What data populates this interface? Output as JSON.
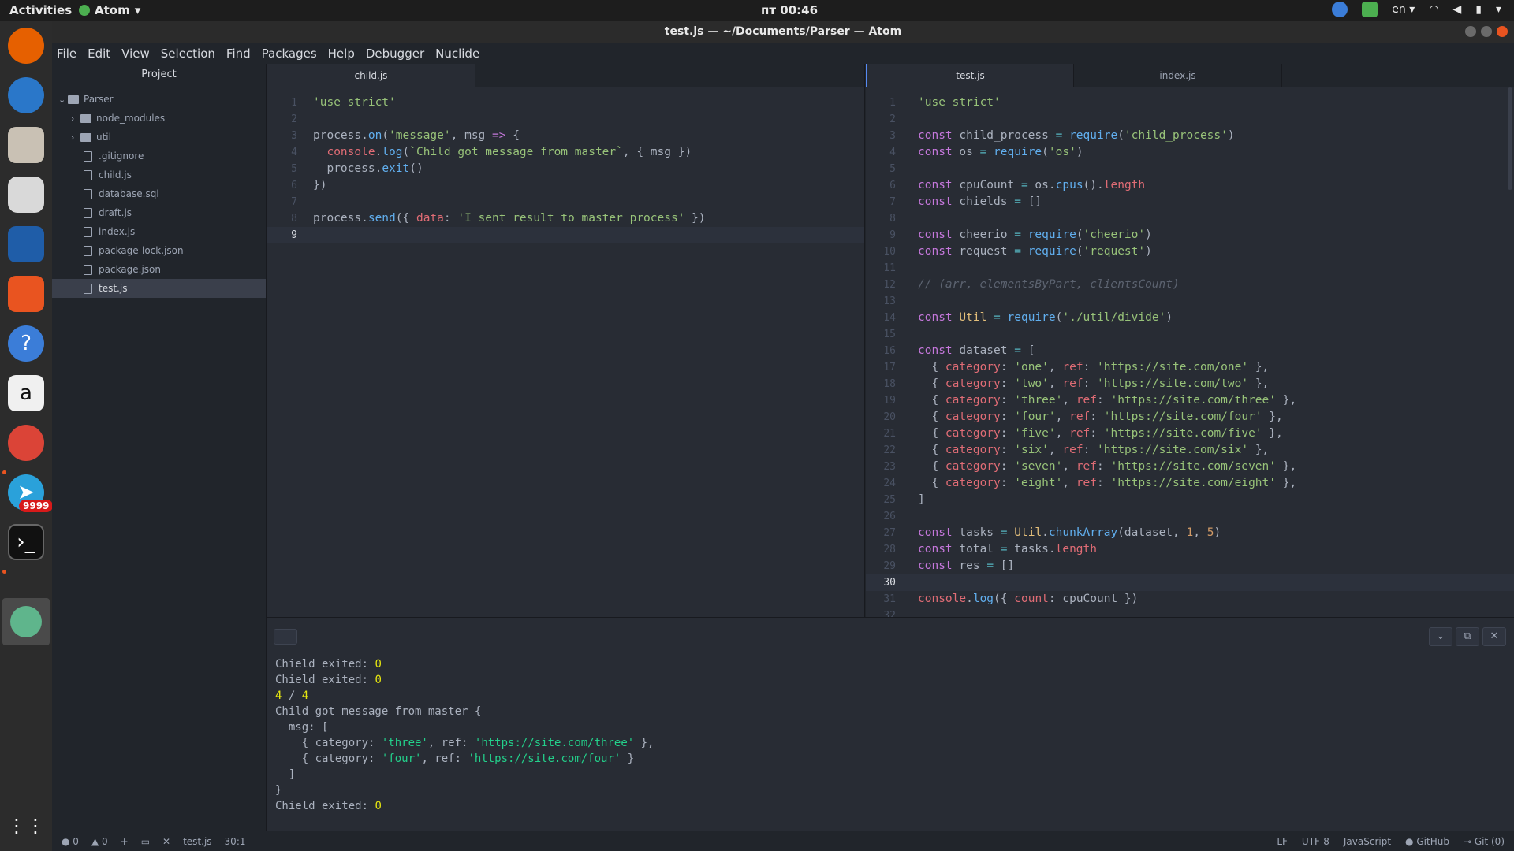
{
  "topbar": {
    "activities": "Activities",
    "app": "Atom",
    "clock": "пт 00:46",
    "lang": "en"
  },
  "window": {
    "title": "test.js — ~/Documents/Parser — Atom"
  },
  "dock": {
    "telegram_badge": "9999"
  },
  "menu": [
    "File",
    "Edit",
    "View",
    "Selection",
    "Find",
    "Packages",
    "Help",
    "Debugger",
    "Nuclide"
  ],
  "tree": {
    "header": "Project",
    "root": "Parser",
    "folders": [
      "node_modules",
      "util"
    ],
    "files": [
      ".gitignore",
      "child.js",
      "database.sql",
      "draft.js",
      "index.js",
      "package-lock.json",
      "package.json",
      "test.js"
    ]
  },
  "left_pane": {
    "tab": "child.js",
    "lines": [
      [
        [
          "s",
          "'use strict'"
        ]
      ],
      [],
      [
        [
          "t",
          "process."
        ],
        [
          "f",
          "on"
        ],
        [
          "t",
          "("
        ],
        [
          "s",
          "'message'"
        ],
        [
          "t",
          ", msg "
        ],
        [
          "k",
          "=>"
        ],
        [
          "t",
          " {"
        ]
      ],
      [
        [
          "t",
          "  "
        ],
        [
          "p",
          "console"
        ],
        [
          "t",
          "."
        ],
        [
          "f",
          "log"
        ],
        [
          "t",
          "("
        ],
        [
          "s",
          "`Child got message from master`"
        ],
        [
          "t",
          ", { msg })"
        ]
      ],
      [
        [
          "t",
          "  process."
        ],
        [
          "f",
          "exit"
        ],
        [
          "t",
          "()"
        ]
      ],
      [
        [
          "t",
          "})"
        ]
      ],
      [],
      [
        [
          "t",
          "process."
        ],
        [
          "f",
          "send"
        ],
        [
          "t",
          "({ "
        ],
        [
          "p",
          "data"
        ],
        [
          "t",
          ": "
        ],
        [
          "s",
          "'I sent result to master process'"
        ],
        [
          "t",
          " })"
        ]
      ],
      []
    ]
  },
  "right_pane": {
    "tabs": [
      "test.js",
      "index.js"
    ],
    "lines": [
      [
        [
          "s",
          "'use strict'"
        ]
      ],
      [],
      [
        [
          "k",
          "const"
        ],
        [
          "t",
          " child_process "
        ],
        [
          "o",
          "="
        ],
        [
          "t",
          " "
        ],
        [
          "f",
          "require"
        ],
        [
          "t",
          "("
        ],
        [
          "s",
          "'child_process'"
        ],
        [
          "t",
          ")"
        ]
      ],
      [
        [
          "k",
          "const"
        ],
        [
          "t",
          " os "
        ],
        [
          "o",
          "="
        ],
        [
          "t",
          " "
        ],
        [
          "f",
          "require"
        ],
        [
          "t",
          "("
        ],
        [
          "s",
          "'os'"
        ],
        [
          "t",
          ")"
        ]
      ],
      [],
      [
        [
          "k",
          "const"
        ],
        [
          "t",
          " cpuCount "
        ],
        [
          "o",
          "="
        ],
        [
          "t",
          " os."
        ],
        [
          "f",
          "cpus"
        ],
        [
          "t",
          "()."
        ],
        [
          "p",
          "length"
        ]
      ],
      [
        [
          "k",
          "const"
        ],
        [
          "t",
          " chields "
        ],
        [
          "o",
          "="
        ],
        [
          "t",
          " []"
        ]
      ],
      [],
      [
        [
          "k",
          "const"
        ],
        [
          "t",
          " cheerio "
        ],
        [
          "o",
          "="
        ],
        [
          "t",
          " "
        ],
        [
          "f",
          "require"
        ],
        [
          "t",
          "("
        ],
        [
          "s",
          "'cheerio'"
        ],
        [
          "t",
          ")"
        ]
      ],
      [
        [
          "k",
          "const"
        ],
        [
          "t",
          " request "
        ],
        [
          "o",
          "="
        ],
        [
          "t",
          " "
        ],
        [
          "f",
          "require"
        ],
        [
          "t",
          "("
        ],
        [
          "s",
          "'request'"
        ],
        [
          "t",
          ")"
        ]
      ],
      [],
      [
        [
          "c",
          "// (arr, elementsByPart, clientsCount)"
        ]
      ],
      [],
      [
        [
          "k",
          "const"
        ],
        [
          "t",
          " "
        ],
        [
          "y",
          "Util"
        ],
        [
          "t",
          " "
        ],
        [
          "o",
          "="
        ],
        [
          "t",
          " "
        ],
        [
          "f",
          "require"
        ],
        [
          "t",
          "("
        ],
        [
          "s",
          "'./util/divide'"
        ],
        [
          "t",
          ")"
        ]
      ],
      [],
      [
        [
          "k",
          "const"
        ],
        [
          "t",
          " dataset "
        ],
        [
          "o",
          "="
        ],
        [
          "t",
          " ["
        ]
      ],
      [
        [
          "t",
          "  { "
        ],
        [
          "p",
          "category"
        ],
        [
          "t",
          ": "
        ],
        [
          "s",
          "'one'"
        ],
        [
          "t",
          ", "
        ],
        [
          "p",
          "ref"
        ],
        [
          "t",
          ": "
        ],
        [
          "s",
          "'https://site.com/one'"
        ],
        [
          "t",
          " },"
        ]
      ],
      [
        [
          "t",
          "  { "
        ],
        [
          "p",
          "category"
        ],
        [
          "t",
          ": "
        ],
        [
          "s",
          "'two'"
        ],
        [
          "t",
          ", "
        ],
        [
          "p",
          "ref"
        ],
        [
          "t",
          ": "
        ],
        [
          "s",
          "'https://site.com/two'"
        ],
        [
          "t",
          " },"
        ]
      ],
      [
        [
          "t",
          "  { "
        ],
        [
          "p",
          "category"
        ],
        [
          "t",
          ": "
        ],
        [
          "s",
          "'three'"
        ],
        [
          "t",
          ", "
        ],
        [
          "p",
          "ref"
        ],
        [
          "t",
          ": "
        ],
        [
          "s",
          "'https://site.com/three'"
        ],
        [
          "t",
          " },"
        ]
      ],
      [
        [
          "t",
          "  { "
        ],
        [
          "p",
          "category"
        ],
        [
          "t",
          ": "
        ],
        [
          "s",
          "'four'"
        ],
        [
          "t",
          ", "
        ],
        [
          "p",
          "ref"
        ],
        [
          "t",
          ": "
        ],
        [
          "s",
          "'https://site.com/four'"
        ],
        [
          "t",
          " },"
        ]
      ],
      [
        [
          "t",
          "  { "
        ],
        [
          "p",
          "category"
        ],
        [
          "t",
          ": "
        ],
        [
          "s",
          "'five'"
        ],
        [
          "t",
          ", "
        ],
        [
          "p",
          "ref"
        ],
        [
          "t",
          ": "
        ],
        [
          "s",
          "'https://site.com/five'"
        ],
        [
          "t",
          " },"
        ]
      ],
      [
        [
          "t",
          "  { "
        ],
        [
          "p",
          "category"
        ],
        [
          "t",
          ": "
        ],
        [
          "s",
          "'six'"
        ],
        [
          "t",
          ", "
        ],
        [
          "p",
          "ref"
        ],
        [
          "t",
          ": "
        ],
        [
          "s",
          "'https://site.com/six'"
        ],
        [
          "t",
          " },"
        ]
      ],
      [
        [
          "t",
          "  { "
        ],
        [
          "p",
          "category"
        ],
        [
          "t",
          ": "
        ],
        [
          "s",
          "'seven'"
        ],
        [
          "t",
          ", "
        ],
        [
          "p",
          "ref"
        ],
        [
          "t",
          ": "
        ],
        [
          "s",
          "'https://site.com/seven'"
        ],
        [
          "t",
          " },"
        ]
      ],
      [
        [
          "t",
          "  { "
        ],
        [
          "p",
          "category"
        ],
        [
          "t",
          ": "
        ],
        [
          "s",
          "'eight'"
        ],
        [
          "t",
          ", "
        ],
        [
          "p",
          "ref"
        ],
        [
          "t",
          ": "
        ],
        [
          "s",
          "'https://site.com/eight'"
        ],
        [
          "t",
          " },"
        ]
      ],
      [
        [
          "t",
          "]"
        ]
      ],
      [],
      [
        [
          "k",
          "const"
        ],
        [
          "t",
          " tasks "
        ],
        [
          "o",
          "="
        ],
        [
          "t",
          " "
        ],
        [
          "y",
          "Util"
        ],
        [
          "t",
          "."
        ],
        [
          "f",
          "chunkArray"
        ],
        [
          "t",
          "(dataset, "
        ],
        [
          "n",
          "1"
        ],
        [
          "t",
          ", "
        ],
        [
          "n",
          "5"
        ],
        [
          "t",
          ")"
        ]
      ],
      [
        [
          "k",
          "const"
        ],
        [
          "t",
          " total "
        ],
        [
          "o",
          "="
        ],
        [
          "t",
          " tasks."
        ],
        [
          "p",
          "length"
        ]
      ],
      [
        [
          "k",
          "const"
        ],
        [
          "t",
          " res "
        ],
        [
          "o",
          "="
        ],
        [
          "t",
          " []"
        ]
      ],
      [],
      [
        [
          "p",
          "console"
        ],
        [
          "t",
          "."
        ],
        [
          "f",
          "log"
        ],
        [
          "t",
          "({ "
        ],
        [
          "p",
          "count"
        ],
        [
          "t",
          ": cpuCount })"
        ]
      ],
      []
    ]
  },
  "console": {
    "lines": [
      [
        [
          "t",
          "Chield exited: "
        ],
        [
          "n",
          "0"
        ]
      ],
      [
        [
          "t",
          "Chield exited: "
        ],
        [
          "n",
          "0"
        ]
      ],
      [
        [
          "n",
          "4"
        ],
        [
          "t",
          " / "
        ],
        [
          "n",
          "4"
        ]
      ],
      [
        [
          "t",
          "Child got message from master {"
        ]
      ],
      [
        [
          "t",
          "  msg: ["
        ]
      ],
      [
        [
          "t",
          "    { category: "
        ],
        [
          "s",
          "'three'"
        ],
        [
          "t",
          ", ref: "
        ],
        [
          "s",
          "'https://site.com/three'"
        ],
        [
          "t",
          " },"
        ]
      ],
      [
        [
          "t",
          "    { category: "
        ],
        [
          "s",
          "'four'"
        ],
        [
          "t",
          ", ref: "
        ],
        [
          "s",
          "'https://site.com/four'"
        ],
        [
          "t",
          " }"
        ]
      ],
      [
        [
          "t",
          "  ]"
        ]
      ],
      [
        [
          "t",
          "}"
        ]
      ],
      [
        [
          "t",
          "Chield exited: "
        ],
        [
          "n",
          "0"
        ]
      ]
    ]
  },
  "status": {
    "errors": "0",
    "warnings": "0",
    "file": "test.js",
    "cursor": "30:1",
    "eol": "LF",
    "encoding": "UTF-8",
    "grammar": "JavaScript",
    "github": "GitHub",
    "git": "Git (0)"
  }
}
